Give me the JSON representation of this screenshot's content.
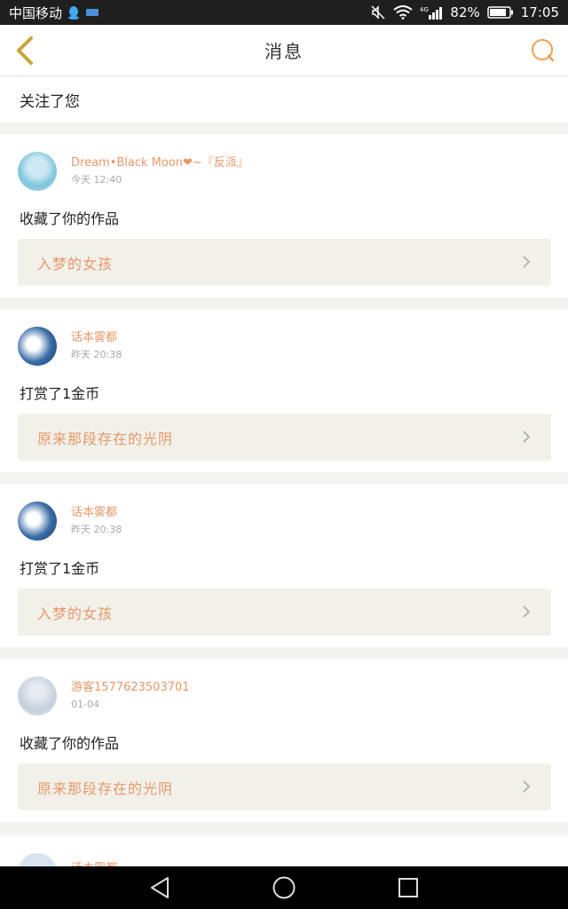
{
  "status_bar": {
    "carrier": "中国移动",
    "battery": "82%",
    "time": "17:05",
    "network": "4G"
  },
  "header": {
    "title": "消息"
  },
  "follow_notice": "关注了您",
  "cards": [
    {
      "user": "Dream•Black Moon❤~『反派』",
      "time": "今天 12:40",
      "action": "收藏了你的作品",
      "work": "入梦的女孩"
    },
    {
      "user": "话本雾都",
      "time": "昨天 20:38",
      "action": "打赏了1金币",
      "work": "原来那段存在的光阴"
    },
    {
      "user": "话本雾都",
      "time": "昨天 20:38",
      "action": "打赏了1金币",
      "work": "入梦的女孩"
    },
    {
      "user": "游客1577623503701",
      "time": "01-04",
      "action": "收藏了你的作品",
      "work": "原来那段存在的光阴"
    }
  ],
  "partial_card": {
    "user": "话本雾都"
  },
  "colors": {
    "accent": "#e89868",
    "back_arrow": "#c9a53a",
    "search_icon": "#f0a050",
    "link_bg": "#f1f1ea"
  }
}
